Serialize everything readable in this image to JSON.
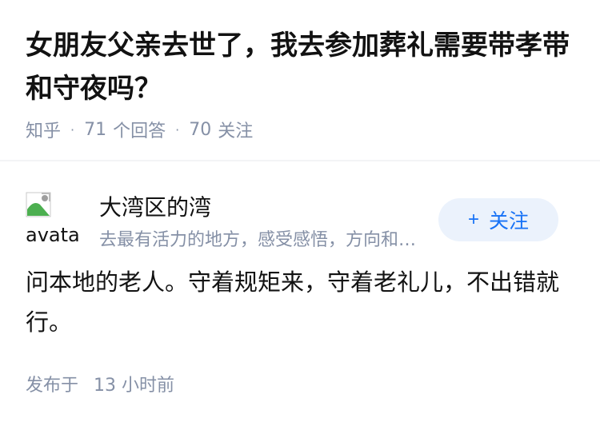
{
  "question": {
    "title": "女朋友父亲去世了，我去参加葬礼需要带孝带和守夜吗？",
    "source": "知乎",
    "answer_count": "71",
    "answer_label": "个回答",
    "follower_count": "70",
    "follower_label": "关注"
  },
  "answer": {
    "author": {
      "avatar_alt": "avatar",
      "name": "大湾区的湾",
      "bio": "去最有活力的地方，感受感悟，方向和积累..."
    },
    "follow_button": {
      "icon": "plus-icon",
      "label": "关注"
    },
    "content": "问本地的老人。守着规矩来，守着老礼儿，不出错就行。",
    "time_prefix": "发布于",
    "time_value": "13 小时前"
  },
  "colors": {
    "accent": "#1772f6",
    "button_bg": "#ebf2fc",
    "meta_text": "#8590a6",
    "primary_text": "#121212"
  }
}
